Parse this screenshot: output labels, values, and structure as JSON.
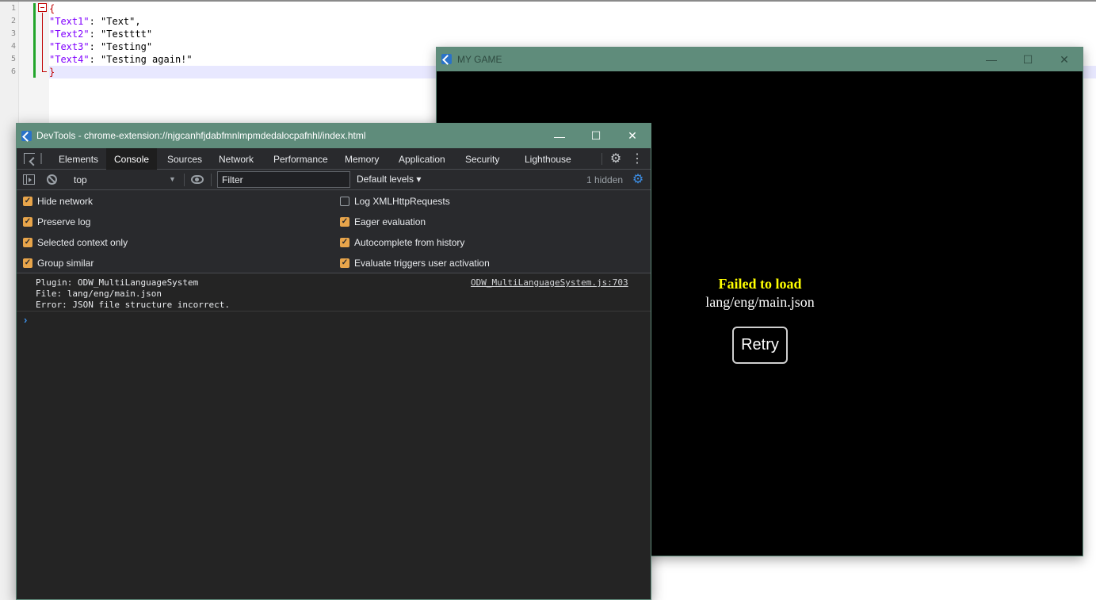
{
  "editor": {
    "line_numbers": [
      "1",
      "2",
      "3",
      "4",
      "5",
      "6"
    ],
    "lines": {
      "open": "{",
      "l2_key": "\"Text1\"",
      "l2_val": ": \"Text\",",
      "l3_key": "\"Text2\"",
      "l3_val": ": \"Testttt\"",
      "l4_key": "\"Text3\"",
      "l4_val": ": \"Testing\"",
      "l5_key": "\"Text4\"",
      "l5_val": ": \"Testing again!\"",
      "close": "}"
    }
  },
  "game_window": {
    "title": "MY GAME",
    "error_title": "Failed to load",
    "error_file": "lang/eng/main.json",
    "retry_label": "Retry",
    "controls": {
      "minimize": "—",
      "maximize": "☐",
      "close": "✕"
    }
  },
  "devtools": {
    "title": "DevTools - chrome-extension://njgcanhfjdabfmnlmpmdedalocpafnhl/index.html",
    "controls": {
      "minimize": "—",
      "maximize": "☐",
      "close": "✕"
    },
    "tabs": [
      "Elements",
      "Console",
      "Sources",
      "Network",
      "Performance",
      "Memory",
      "Application",
      "Security",
      "Lighthouse"
    ],
    "active_tab": "Console",
    "toolbar": {
      "context": "top",
      "filter_placeholder": "Filter",
      "levels": "Default levels ▾",
      "hidden": "1 hidden"
    },
    "settings": {
      "left": [
        {
          "label": "Hide network",
          "checked": true
        },
        {
          "label": "Preserve log",
          "checked": true
        },
        {
          "label": "Selected context only",
          "checked": true
        },
        {
          "label": "Group similar",
          "checked": true
        }
      ],
      "right": [
        {
          "label": "Log XMLHttpRequests",
          "checked": false
        },
        {
          "label": "Eager evaluation",
          "checked": true
        },
        {
          "label": "Autocomplete from history",
          "checked": true
        },
        {
          "label": "Evaluate triggers user activation",
          "checked": true
        }
      ]
    },
    "log": {
      "line1": "Plugin: ODW_MultiLanguageSystem",
      "line2": "File: lang/eng/main.json",
      "line3": "Error: JSON file structure incorrect.",
      "source": "ODW_MultiLanguageSystem.js:703"
    },
    "prompt": "›"
  },
  "icons": {
    "gear": "⚙",
    "kebab": "⋮",
    "checkmark": "✓"
  },
  "colors": {
    "titlebar": "#5f8c7b",
    "error_title": "#ffff00",
    "checkbox_on": "#e8a54b",
    "prompt": "#3d8fe6"
  }
}
